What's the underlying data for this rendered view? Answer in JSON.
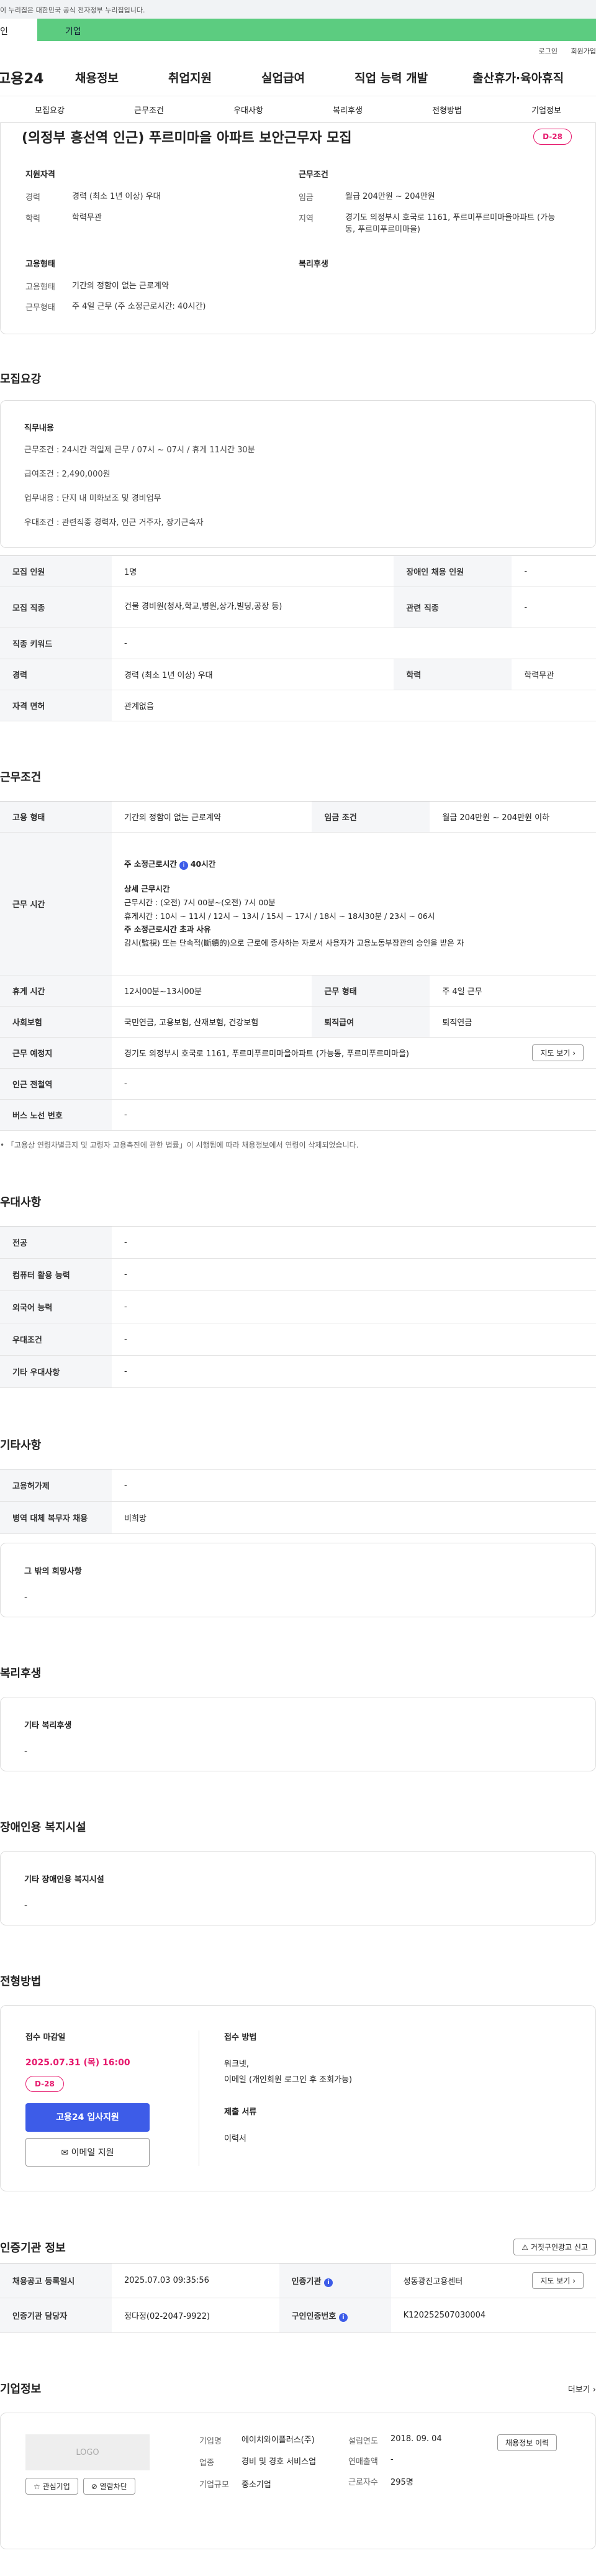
{
  "gov_banner": "이 누리집은 대한민국 공식 전자정부 누리집입니다.",
  "user_tabs": {
    "left": "인",
    "right": "기업"
  },
  "login_links": [
    "로그인",
    "회원가입"
  ],
  "gnb": {
    "logo": "고용24",
    "menus": [
      "채용정보",
      "취업지원",
      "실업급여",
      "직업 능력 개발",
      "출산휴가·육아휴직"
    ]
  },
  "subnav": [
    "모집요강",
    "근무조건",
    "우대사항",
    "복리후생",
    "전형방법",
    "기업정보"
  ],
  "header": {
    "title": "(의정부 흥선역 인근) 푸르미마을 아파트 보안근무자 모집",
    "dday": "D-28",
    "qual_title": "지원자격",
    "qual": [
      {
        "k": "경력",
        "v": "경력 (최소 1년 이상) 우대"
      },
      {
        "k": "학력",
        "v": "학력무관"
      }
    ],
    "cond_title": "근무조건",
    "cond": [
      {
        "k": "임금",
        "v": "월급 204만원 ~ 204만원"
      },
      {
        "k": "지역",
        "v": "경기도 의정부시 호국로 1161, 푸르미푸르미마을아파트 (가능동, 푸르미푸르미마을)"
      }
    ],
    "type_title": "고용형태",
    "types": [
      {
        "k": "고용형태",
        "v": "기간의 정함이 없는 근로계약"
      },
      {
        "k": "근무형태",
        "v": "주 4일 근무 (주 소정근로시간: 40시간)"
      }
    ],
    "welfare_title": "복리후생"
  },
  "recruit": {
    "heading": "모집요강",
    "desc_title": "직무내용",
    "desc_lines": [
      "근무조건 : 24시간 격일제 근무 / 07시 ~ 07시 / 휴게 11시간 30분",
      "급여조건 : 2,490,000원",
      "업무내용 : 단지 내 미화보조 및 경비업무",
      "우대조건 : 관련직종 경력자, 인근 거주자, 장기근속자"
    ],
    "rows": [
      {
        "k1": "모집 인원",
        "v1": "1명",
        "k2": "장애인 채용 인원",
        "v2": "-"
      },
      {
        "k1": "모집 직종",
        "v1": "건물 경비원(청사,학교,병원,상가,빌딩,공장 등)",
        "k2": "관련 직종",
        "v2": "-"
      },
      {
        "k1": "직종 키워드",
        "v1": "-"
      },
      {
        "k1": "경력",
        "v1": "경력 (최소 1년 이상) 우대",
        "k2": "학력",
        "v2": "학력무관"
      },
      {
        "k1": "자격 면허",
        "v1": "관계없음"
      }
    ]
  },
  "work": {
    "heading": "근무조건",
    "type_k": "고용 형태",
    "type_v": "기간의 정함이 없는 근로계약",
    "wage_k": "임금 조건",
    "wage_v": "월급 204만원 ~ 204만원 이하",
    "time_k": "근무 시간",
    "time_lines": [
      "주 소정근로시간",
      "40시간",
      "상세 근무시간",
      "근무시간 : (오전) 7시 00분~(오전) 7시 00분",
      "휴게시간 : 10시 ~ 11시 / 12시 ~ 13시 / 15시 ~ 17시 / 18시 ~ 18시30분 / 23시 ~ 06시",
      "주 소정근로시간 초과 사유",
      "감시(監視) 또는 단속적(斷續的)으로 근로에 종사하는 자로서 사용자가 고용노동부장관의 승인을 받은 자"
    ],
    "break_k": "휴게 시간",
    "break_v": "12시00분~13시00분",
    "form_k": "근무 형태",
    "form_v": "주 4일 근무",
    "ins_k": "사회보험",
    "ins_v": "국민연금, 고용보험, 산재보험, 건강보험",
    "ret_k": "퇴직급여",
    "ret_v": "퇴직연금",
    "place_k": "근무 예정지",
    "place_v": "경기도 의정부시 호국로 1161, 푸르미푸르미마을아파트 (가능동, 푸르미푸르미마을)",
    "map_btn": "지도 보기",
    "sub_k": "인근 전철역",
    "sub_v": "-",
    "bus_k": "버스 노선 번호",
    "bus_v": "-",
    "note": "「고용상 연령차별금지 및 고령자 고용촉진에 관한 법률」이 시행됨에 따라 채용정보에서 연령이 삭제되었습니다."
  },
  "pref": {
    "heading": "우대사항",
    "rows": [
      {
        "k": "전공",
        "v": "-"
      },
      {
        "k": "컴퓨터 활용 능력",
        "v": "-"
      },
      {
        "k": "외국어 능력",
        "v": "-"
      },
      {
        "k": "우대조건",
        "v": "-"
      },
      {
        "k": "기타 우대사항",
        "v": "-"
      }
    ]
  },
  "etc": {
    "heading": "기타사항",
    "rows": [
      {
        "k": "고용허가제",
        "v": "-"
      },
      {
        "k": "병역 대체 복무자 채용",
        "v": "비희망"
      }
    ],
    "box_title": "그 밖의 희망사항",
    "box_val": "-"
  },
  "welfare": {
    "heading": "복리후생",
    "box_title": "기타 복리후생",
    "box_val": "-"
  },
  "disab": {
    "heading": "장애인용 복지시설",
    "box_title": "기타 장애인용 복지시설",
    "box_val": "-"
  },
  "apply": {
    "heading": "전형방법",
    "deadline_label": "접수 마감일",
    "deadline": "2025.07.31 (목) 16:00",
    "dday": "D-28",
    "apply_btn": "고용24 입사지원",
    "email_btn": "이메일 지원",
    "method_label": "접수 방법",
    "methods": [
      "워크넷,",
      "이메일 (개인회원 로그인 후 조회가능)"
    ],
    "docs_label": "제출 서류",
    "docs": "이력서"
  },
  "cert": {
    "heading": "인증기관 정보",
    "report_btn": "거짓구인광고 신고",
    "r1": {
      "k1": "채용공고 등록일시",
      "v1": "2025.07.03 09:35:56",
      "k2": "인증기관",
      "v2": "성동광진고용센터",
      "btn": "지도 보기"
    },
    "r2": {
      "k1": "인증기관 담당자",
      "v1": "정다정(02-2047-9922)",
      "k2": "구인인증번호",
      "v2": "K120252507030004"
    }
  },
  "company": {
    "heading": "기업정보",
    "more": "더보기",
    "logo": "LOGO",
    "fav_btn": "관심기업",
    "block_btn": "열람차단",
    "name_k": "기업명",
    "name_v": "에이치와이플러스(주)",
    "ind_k": "업종",
    "ind_v": "경비 및 경호 서비스업",
    "size_k": "기업규모",
    "size_v": "중소기업",
    "est_k": "설립연도",
    "est_v": "2018. 09. 04",
    "rev_k": "연매출액",
    "rev_v": "-",
    "emp_k": "근로자수",
    "emp_v": "295명",
    "jobs_btn": "채용정보 이력"
  }
}
